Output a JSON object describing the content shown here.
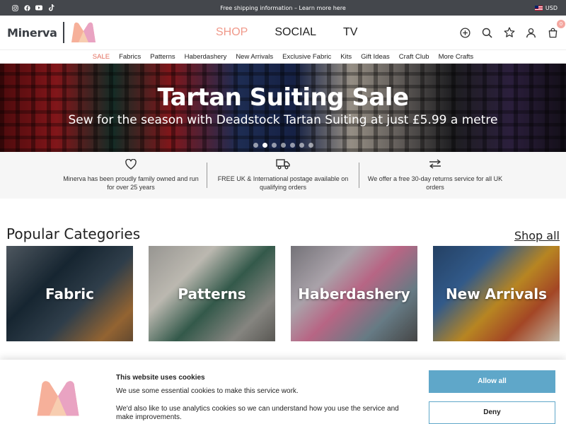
{
  "topbar": {
    "shipping_text": "Free shipping information – Learn more here",
    "currency": "USD",
    "socials": [
      "instagram-icon",
      "facebook-icon",
      "youtube-icon",
      "tiktok-icon"
    ]
  },
  "header": {
    "logo_text": "Minerva",
    "nav": [
      {
        "label": "SHOP"
      },
      {
        "label": "SOCIAL"
      },
      {
        "label": "TV"
      }
    ],
    "cart_count": "0",
    "accent_color": "#f0998a"
  },
  "subnav": {
    "items": [
      "SALE",
      "Fabrics",
      "Patterns",
      "Haberdashery",
      "New Arrivals",
      "Exclusive Fabric",
      "Kits",
      "Gift Ideas",
      "Craft Club",
      "More Crafts"
    ]
  },
  "hero": {
    "title": "Tartan Suiting Sale",
    "subtitle": "Sew for the season with Deadstock Tartan Suiting at just £5.99 a metre",
    "slide_count": 7,
    "active_slide": 2
  },
  "usps": [
    {
      "icon": "heart-icon",
      "text": "Minerva has been proudly family owned and run for over 25 years"
    },
    {
      "icon": "truck-icon",
      "text": "FREE UK & International postage available on qualifying orders"
    },
    {
      "icon": "exchange-icon",
      "text": "We offer a free 30-day returns service for all UK orders"
    }
  ],
  "categories": {
    "title": "Popular Categories",
    "shop_all": "Shop all",
    "items": [
      {
        "label": "Fabric"
      },
      {
        "label": "Patterns"
      },
      {
        "label": "Haberdashery"
      },
      {
        "label": "New Arrivals"
      }
    ]
  },
  "cookie": {
    "title": "This website uses cookies",
    "line1": "We use some essential cookies to make this service work.",
    "line2": "We'd also like to use analytics cookies so we can understand how you use the service and make improvements.",
    "allow_label": "Allow all",
    "deny_label": "Deny",
    "button_color": "#5fa7c9"
  }
}
